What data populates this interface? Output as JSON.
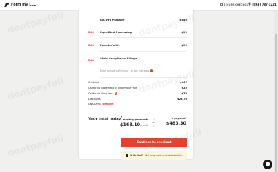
{
  "header": {
    "brand_name": "Form my LLC",
    "secure_checkout_label": "SECURE CHECKOUT",
    "phone_number": "(866) 787-1221"
  },
  "order_items": [
    {
      "name": "LLC Pro Package",
      "price": "$349",
      "edit_label": "Edit"
    },
    {
      "name": "Expedited Processing",
      "price": "$99",
      "edit_label": "Edit"
    },
    {
      "name": "Founder's Kit",
      "price": "$99",
      "edit_label": "Edit"
    },
    {
      "name": "State Compliance Filings",
      "price": "",
      "edit_label": "Edit",
      "note": "Billed annually after your 1st day trial ends"
    }
  ],
  "summary": {
    "subtotal_label": "Subtotal",
    "subtotal_value": "$447",
    "statement_label": "California Statement of Information fee",
    "statement_value": "$25",
    "filing_label": "California filing fees",
    "filing_value": "$70",
    "discounts_label": "Discounts",
    "discounts_value": "-$23.70",
    "coupon_code": "UNIQ0090",
    "remove_label": "Remove"
  },
  "total": {
    "label": "Your total today",
    "footnote_mark": "*",
    "installment_title": "3 monthly payments",
    "installment_footnote": "*",
    "installment_amount": "$168.10",
    "installment_unit": "/month",
    "or_label": "or",
    "single_title": "1 payment",
    "single_amount": "$483.30"
  },
  "cta": {
    "label": "Continue to checkout"
  },
  "writeoff": {
    "bold_text": "Write it off!",
    "text": "LLC setup costs are tax deductible."
  },
  "colors": {
    "accent": "#e5412d",
    "note_bg": "#fbf6dd",
    "page_bg": "#f0f0ee"
  },
  "watermark_text": "dontpayfull"
}
